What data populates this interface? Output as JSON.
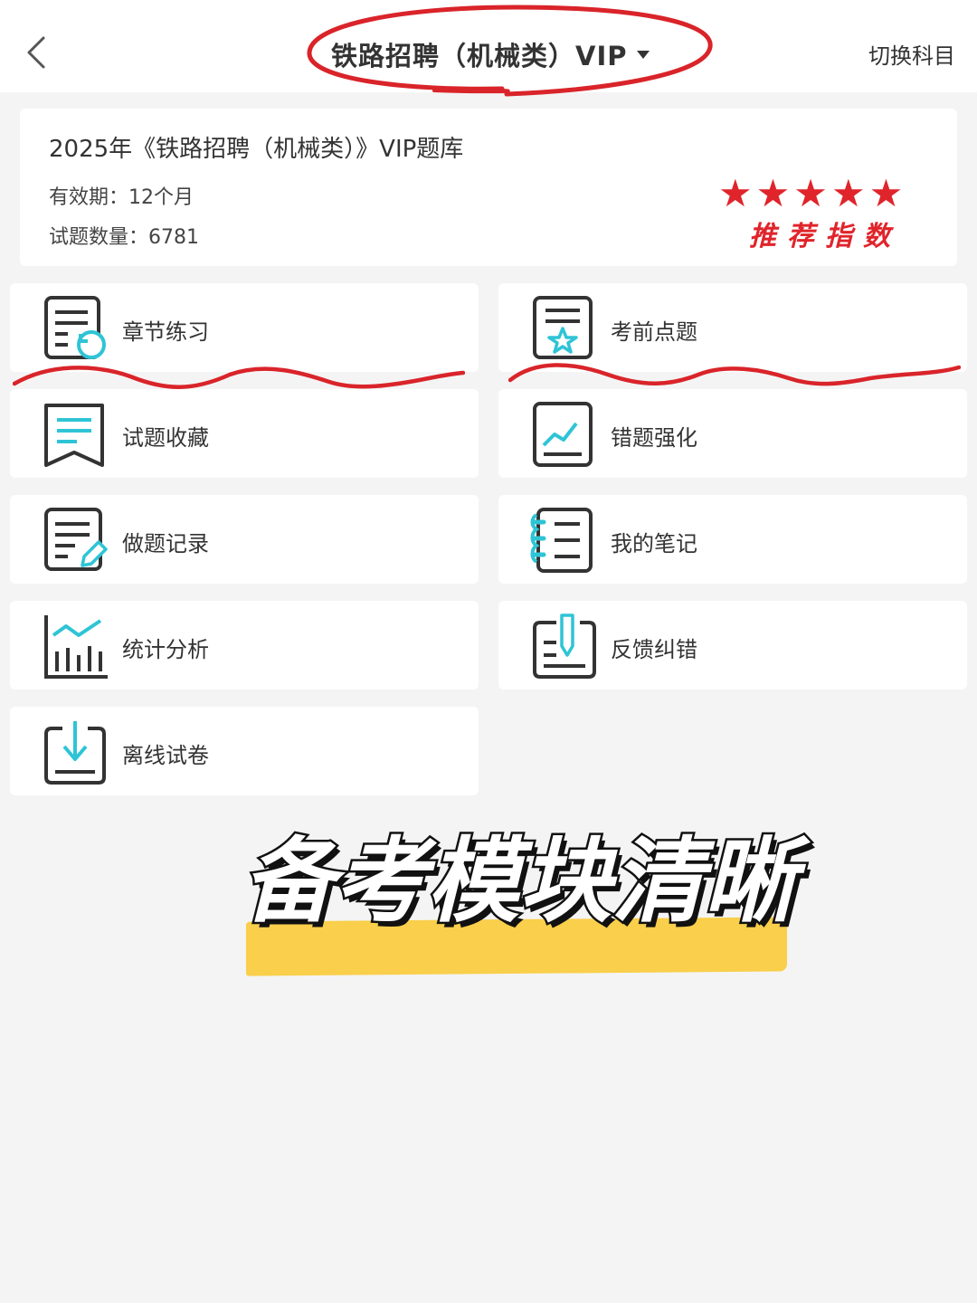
{
  "header": {
    "title": "铁路招聘（机械类）VIP",
    "switch_label": "切换科目"
  },
  "info": {
    "title": "2025年《铁路招聘（机械类）》VIP题库",
    "validity": "有效期：12个月",
    "count": "试题数量：6781",
    "stars": "★★★★★",
    "rating_label": "推荐指数"
  },
  "modules": [
    {
      "label": "章节练习",
      "icon": "chapter-practice-icon"
    },
    {
      "label": "考前点题",
      "icon": "pre-exam-star-icon"
    },
    {
      "label": "试题收藏",
      "icon": "bookmark-icon"
    },
    {
      "label": "错题强化",
      "icon": "wrong-answers-chart-icon"
    },
    {
      "label": "做题记录",
      "icon": "record-pencil-icon"
    },
    {
      "label": "我的笔记",
      "icon": "notebook-icon"
    },
    {
      "label": "统计分析",
      "icon": "statistics-chart-icon"
    },
    {
      "label": "反馈纠错",
      "icon": "feedback-icon"
    },
    {
      "label": "离线试卷",
      "icon": "download-icon"
    }
  ],
  "caption": "备考模块清晰",
  "colors": {
    "accent_red": "#e0242b",
    "icon_teal": "#2ec4d6",
    "highlight_yellow": "#f9cf4b"
  }
}
